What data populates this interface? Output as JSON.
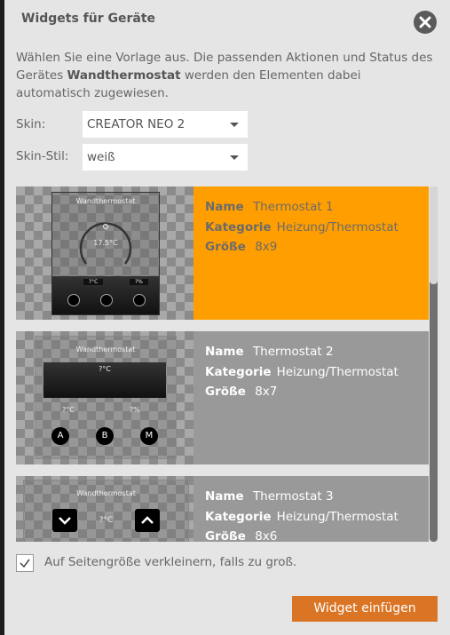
{
  "dialog": {
    "title": "Widgets für Geräte",
    "description_pre": "Wählen Sie eine Vorlage aus. Die passenden Aktionen und Status des Gerätes ",
    "device_name": "Wandthermostat",
    "description_post": " werden den Elementen dabei automatisch zugewiesen."
  },
  "form": {
    "skin_label": "Skin:",
    "skin_value": "CREATOR NEO 2",
    "style_label": "Skin-Stil:",
    "style_value": "weiß"
  },
  "field_labels": {
    "name": "Name",
    "category": "Kategorie",
    "size": "Größe"
  },
  "widgets": [
    {
      "name": "Thermostat 1",
      "category": "Heizung/Thermostat",
      "size": "8x9",
      "selected": true,
      "preview": {
        "title": "Wandthermostat",
        "temp": "17.5°C",
        "val1": "?°C",
        "val2": "?%"
      }
    },
    {
      "name": "Thermostat 2",
      "category": "Heizung/Thermostat",
      "size": "8x7",
      "selected": false,
      "preview": {
        "title": "Wandthermostat",
        "temp": "?°C",
        "val1": "?°C",
        "val2": "?%",
        "btn_a": "A",
        "btn_b": "B",
        "btn_m": "M"
      }
    },
    {
      "name": "Thermostat 3",
      "category": "Heizung/Thermostat",
      "size": "8x6",
      "selected": false,
      "preview": {
        "title": "Wandthermostat",
        "temp": "?°C"
      }
    }
  ],
  "footer": {
    "shrink_checkbox_label": "Auf Seitengröße verkleinern, falls zu groß.",
    "shrink_checked": true,
    "insert_button": "Widget einfügen"
  },
  "colors": {
    "selected": "#ff9e00",
    "button": "#db7526"
  }
}
